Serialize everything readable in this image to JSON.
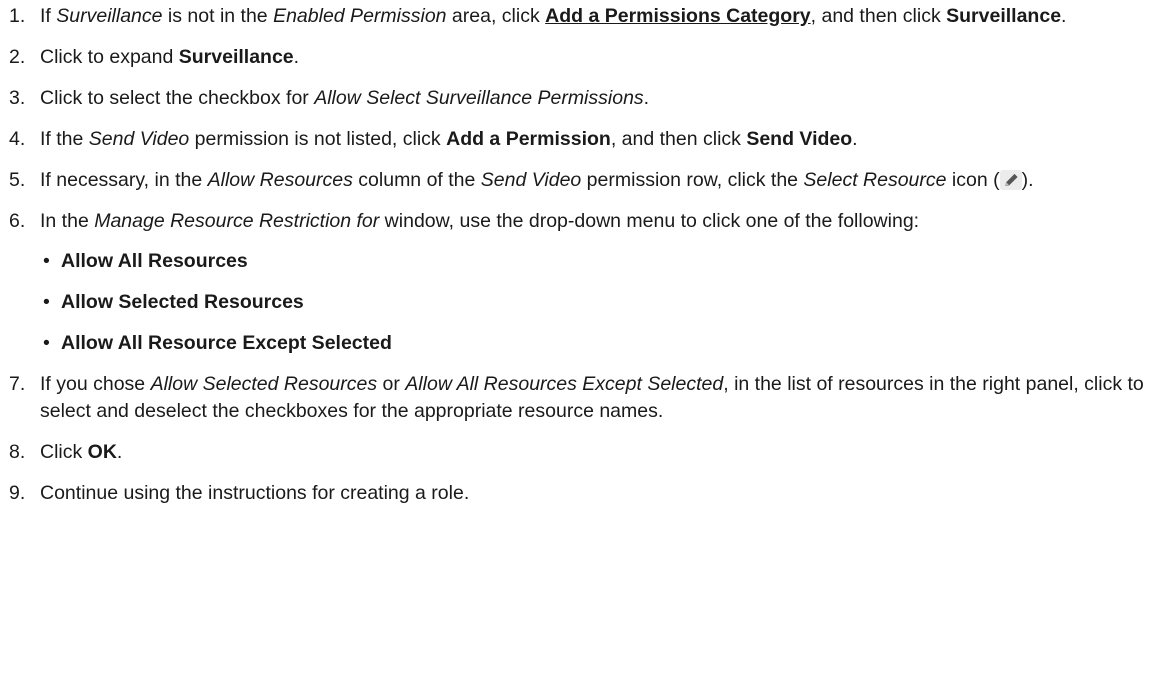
{
  "steps": [
    {
      "num": "1.",
      "parts": [
        {
          "t": "If "
        },
        {
          "t": "Surveillance",
          "s": "i"
        },
        {
          "t": " is not in the "
        },
        {
          "t": "Enabled Permission",
          "s": "i"
        },
        {
          "t": " area, click "
        },
        {
          "t": "Add a Permissions Category",
          "s": "bu"
        },
        {
          "t": ", and then click "
        },
        {
          "t": "Surveillance",
          "s": "b"
        },
        {
          "t": "."
        }
      ]
    },
    {
      "num": "2.",
      "parts": [
        {
          "t": "Click to expand "
        },
        {
          "t": "Surveillance",
          "s": "b"
        },
        {
          "t": "."
        }
      ]
    },
    {
      "num": "3.",
      "parts": [
        {
          "t": "Click to select the checkbox for "
        },
        {
          "t": "Allow Select Surveillance Permissions",
          "s": "i"
        },
        {
          "t": "."
        }
      ]
    },
    {
      "num": "4.",
      "parts": [
        {
          "t": "If the "
        },
        {
          "t": "Send Video",
          "s": "i"
        },
        {
          "t": " permission is not listed, click "
        },
        {
          "t": "Add a Permission",
          "s": "b"
        },
        {
          "t": ", and then click "
        },
        {
          "t": "Send Video",
          "s": "b"
        },
        {
          "t": "."
        }
      ]
    },
    {
      "num": "5.",
      "parts": [
        {
          "t": "If necessary, in the "
        },
        {
          "t": "Allow Resources",
          "s": "i"
        },
        {
          "t": " column of the "
        },
        {
          "t": "Send Video",
          "s": "i"
        },
        {
          "t": " permission row, click the "
        },
        {
          "t": "Select Resource",
          "s": "i"
        },
        {
          "t": " icon ("
        },
        {
          "icon": "pencil-icon"
        },
        {
          "t": ")."
        }
      ]
    },
    {
      "num": "6.",
      "parts": [
        {
          "t": "In the "
        },
        {
          "t": "Manage Resource Restriction for",
          "s": "i"
        },
        {
          "t": " window, use the drop-down menu to click one of the following:"
        }
      ],
      "sub": [
        "Allow All Resources",
        "Allow Selected Resources",
        "Allow All Resource Except Selected"
      ]
    },
    {
      "num": "7.",
      "parts": [
        {
          "t": "If you chose "
        },
        {
          "t": "Allow Selected Resources",
          "s": "i"
        },
        {
          "t": " or "
        },
        {
          "t": "Allow All Resources Except Selected",
          "s": "i"
        },
        {
          "t": ", in the list of resources in the right panel, click to select and deselect the checkboxes for the appropriate resource names."
        }
      ]
    },
    {
      "num": "8.",
      "parts": [
        {
          "t": "Click "
        },
        {
          "t": "OK",
          "s": "b"
        },
        {
          "t": "."
        }
      ]
    },
    {
      "num": "9.",
      "parts": [
        {
          "t": "Continue using the instructions for creating a role."
        }
      ]
    }
  ],
  "bullet_char": "•",
  "colors": {
    "text": "#1a1a1a",
    "icon_pencil": "#555555",
    "icon_bg": "#ececec"
  }
}
